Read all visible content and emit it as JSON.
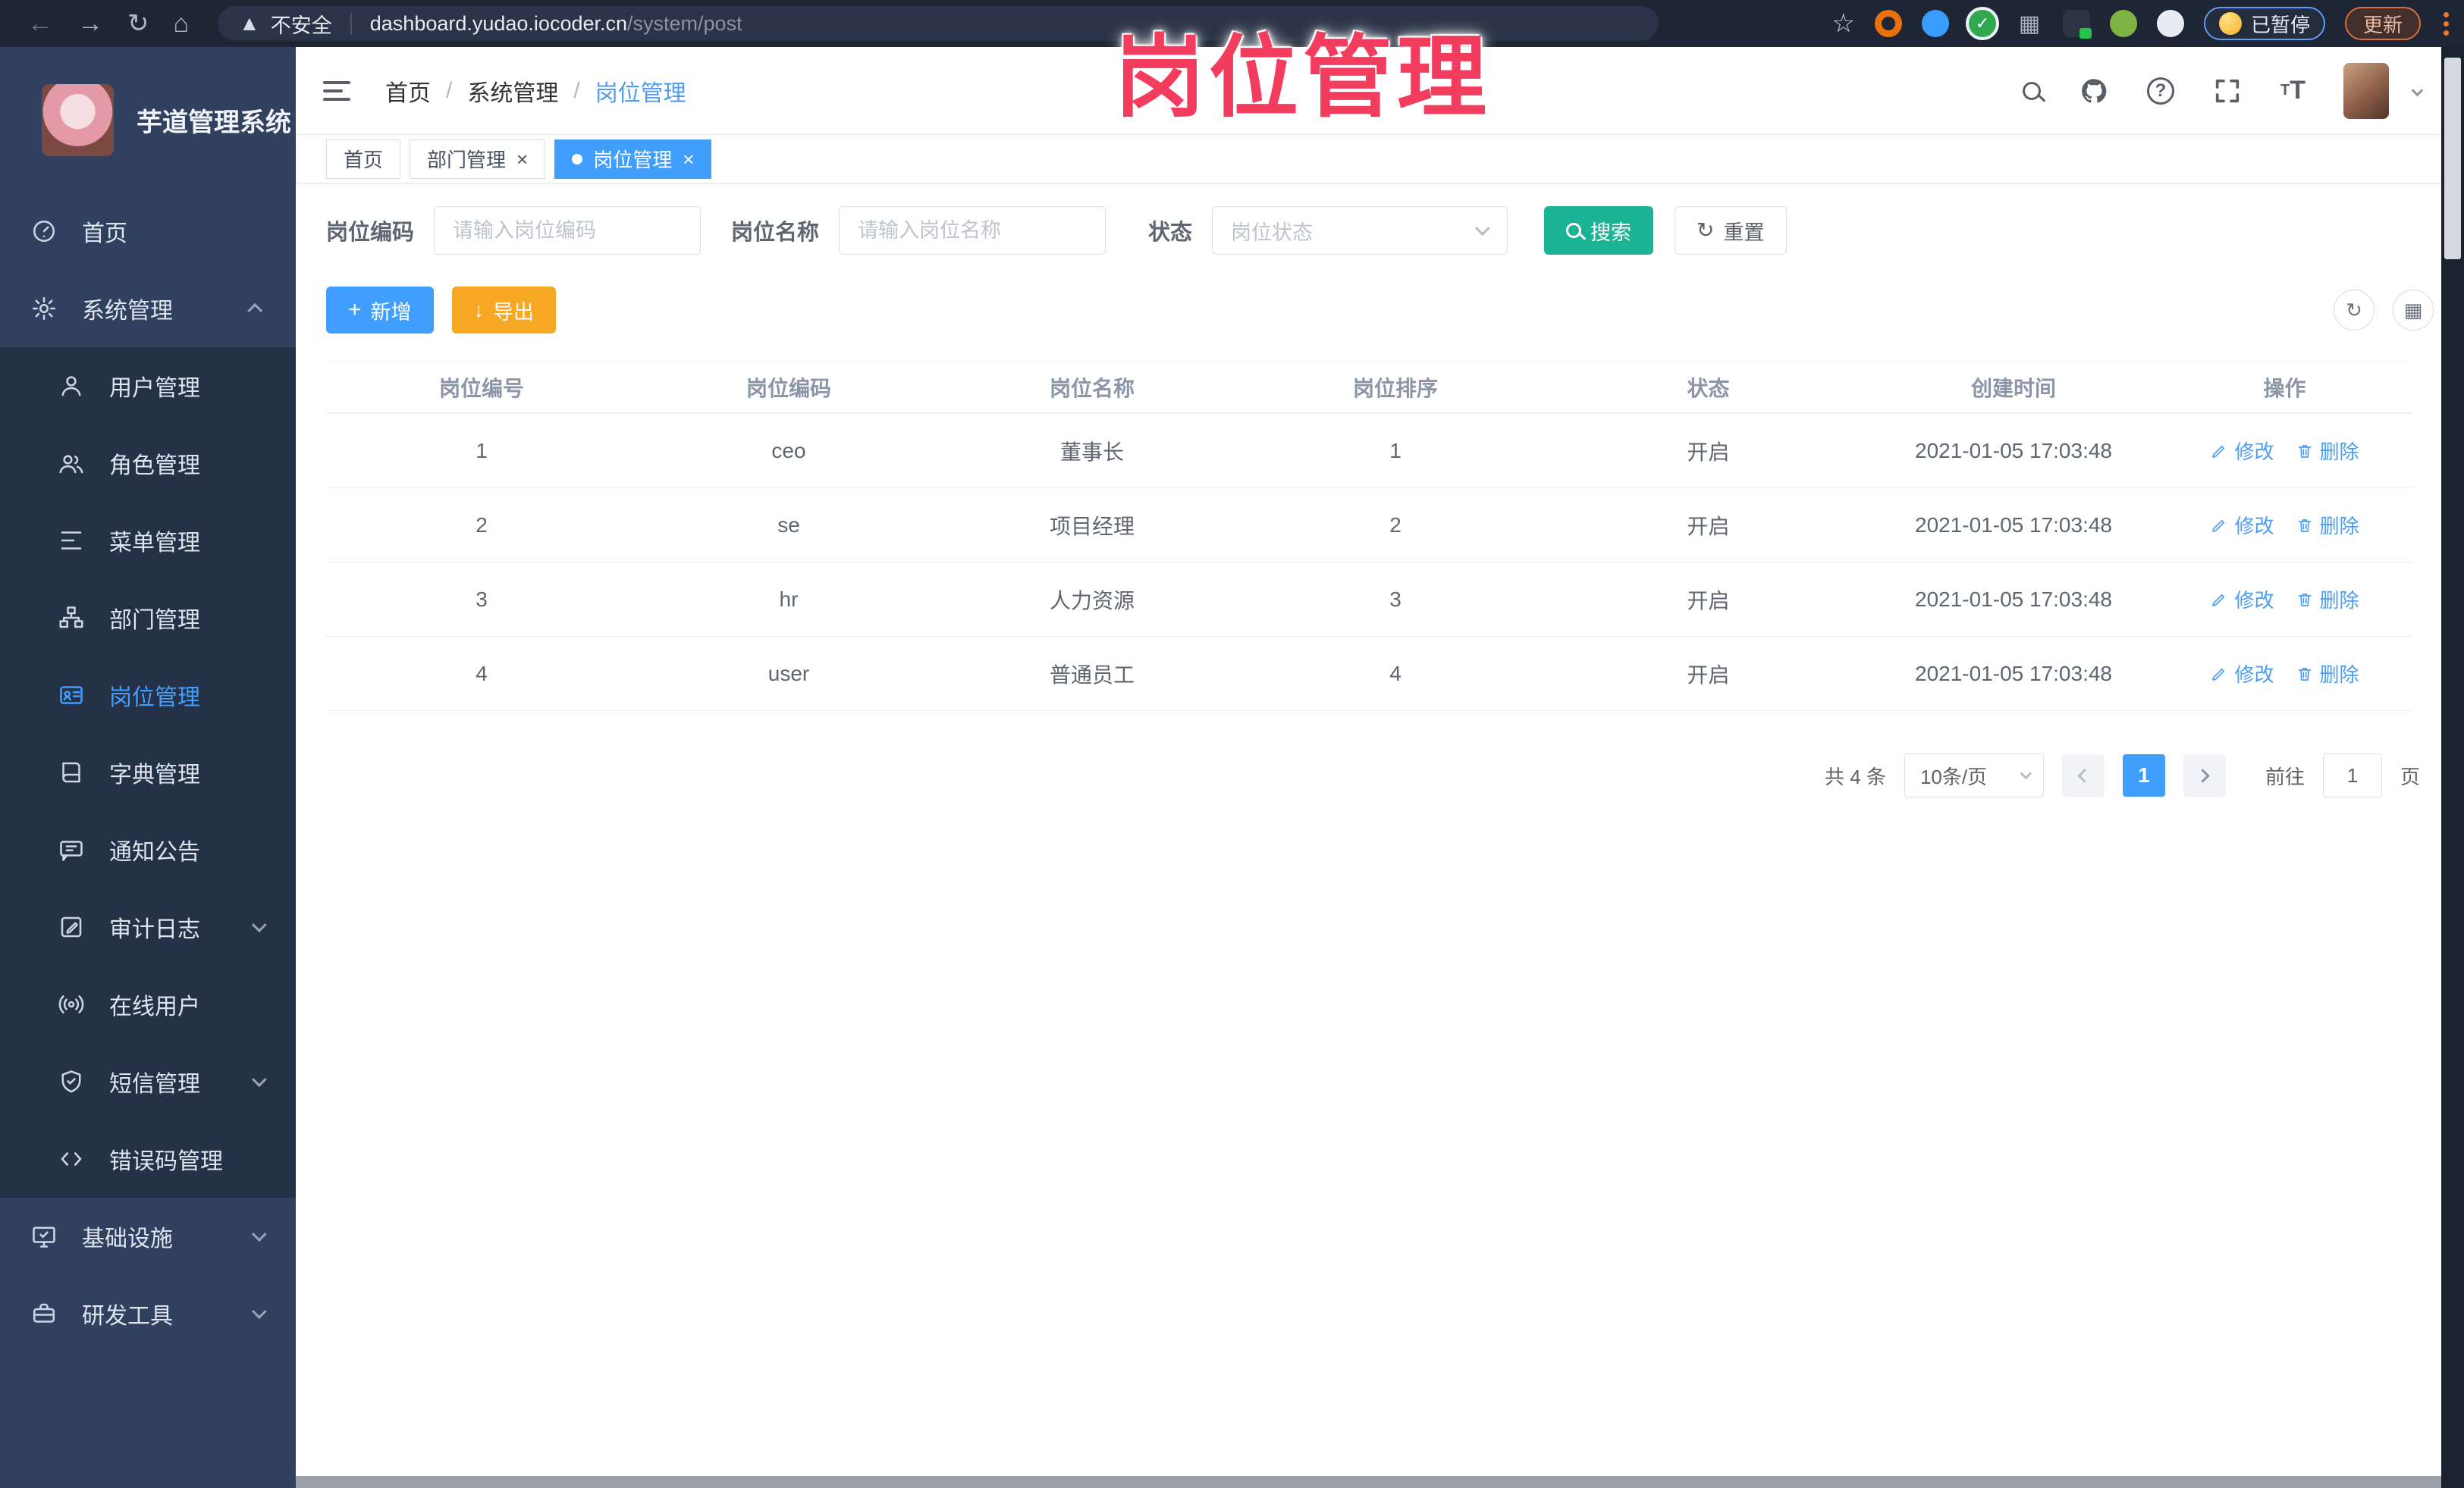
{
  "overlay_title": "岗位管理",
  "browser": {
    "security_label": "不安全",
    "url_host": "dashboard.yudao.iocoder.cn",
    "url_path": "/system/post",
    "paused_label": "已暂停",
    "update_label": "更新"
  },
  "sidebar": {
    "app_title": "芋道管理系统",
    "items": [
      {
        "label": "首页"
      },
      {
        "label": "系统管理"
      },
      {
        "label": "用户管理"
      },
      {
        "label": "角色管理"
      },
      {
        "label": "菜单管理"
      },
      {
        "label": "部门管理"
      },
      {
        "label": "岗位管理"
      },
      {
        "label": "字典管理"
      },
      {
        "label": "通知公告"
      },
      {
        "label": "审计日志"
      },
      {
        "label": "在线用户"
      },
      {
        "label": "短信管理"
      },
      {
        "label": "错误码管理"
      },
      {
        "label": "基础设施"
      },
      {
        "label": "研发工具"
      }
    ]
  },
  "header": {
    "breadcrumb": [
      "首页",
      "系统管理",
      "岗位管理"
    ],
    "separator": "/"
  },
  "tabs": [
    {
      "label": "首页"
    },
    {
      "label": "部门管理"
    },
    {
      "label": "岗位管理"
    }
  ],
  "filters": {
    "code_label": "岗位编码",
    "code_placeholder": "请输入岗位编码",
    "name_label": "岗位名称",
    "name_placeholder": "请输入岗位名称",
    "status_label": "状态",
    "status_placeholder": "岗位状态",
    "search_label": "搜索",
    "reset_label": "重置"
  },
  "toolbar": {
    "add_label": "新增",
    "export_label": "导出"
  },
  "table": {
    "columns": [
      "岗位编号",
      "岗位编码",
      "岗位名称",
      "岗位排序",
      "状态",
      "创建时间",
      "操作"
    ],
    "rows": [
      {
        "no": "1",
        "code": "ceo",
        "name": "董事长",
        "sort": "1",
        "status": "开启",
        "created": "2021-01-05 17:03:48"
      },
      {
        "no": "2",
        "code": "se",
        "name": "项目经理",
        "sort": "2",
        "status": "开启",
        "created": "2021-01-05 17:03:48"
      },
      {
        "no": "3",
        "code": "hr",
        "name": "人力资源",
        "sort": "3",
        "status": "开启",
        "created": "2021-01-05 17:03:48"
      },
      {
        "no": "4",
        "code": "user",
        "name": "普通员工",
        "sort": "4",
        "status": "开启",
        "created": "2021-01-05 17:03:48"
      }
    ],
    "edit_label": "修改",
    "delete_label": "删除"
  },
  "pagination": {
    "total": "共 4 条",
    "page_size": "10条/页",
    "current_page": "1",
    "goto_label": "前往",
    "goto_value": "1",
    "page_unit": "页"
  },
  "colors": {
    "accent": "#409eff",
    "search_teal": "#1ab394",
    "export_orange": "#f6a723",
    "title_pink": "#f33d5e",
    "sidebar_bg": "#31405f",
    "submenu_bg": "#243147"
  }
}
